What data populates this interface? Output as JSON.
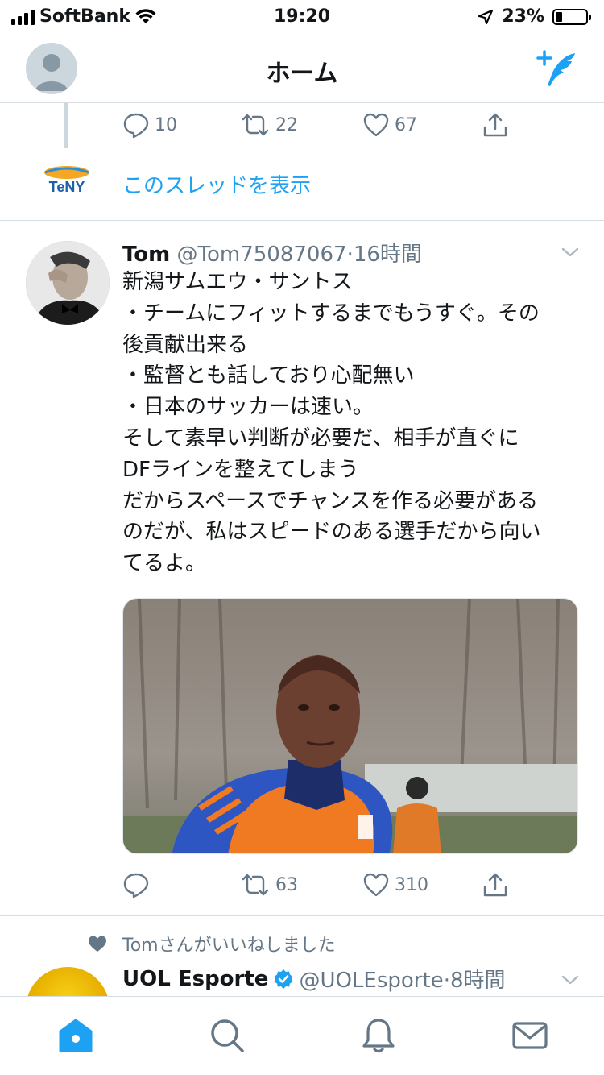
{
  "status_bar": {
    "carrier": "SoftBank",
    "time": "19:20",
    "battery_percent": "23%",
    "battery_level": 0.23
  },
  "header": {
    "title": "ホーム",
    "avatar_icon": "default-profile-icon",
    "compose_icon": "compose-tweet-icon"
  },
  "thread_tail": {
    "reply_count": "10",
    "retweet_count": "22",
    "like_count": "67",
    "show_thread_label": "このスレッドを表示",
    "logo_text": "TeNY"
  },
  "tweet": {
    "name": "Tom",
    "handle": "@Tom75087067",
    "separator": "·",
    "time": "16時間",
    "lines": [
      "新潟サムエウ・サントス",
      "・チームにフィットするまでもうすぐ。その",
      "後貢献出来る",
      "・監督とも話しており心配無い",
      "・日本のサッカーは速い。",
      "そして素早い判断が必要だ、相手が直ぐに",
      "DFラインを整えてしまう",
      "だからスペースでチャンスを作る必要がある",
      "のだが、私はスピードのある選手だから向い",
      "てるよ。"
    ],
    "reply_count": "",
    "retweet_count": "63",
    "like_count": "310"
  },
  "liked_notice": {
    "text": "Tomさんがいいねしました"
  },
  "next_tweet": {
    "name": "UOL Esporte",
    "handle": "@UOLEsporte",
    "separator": "·",
    "time": "8時間"
  },
  "tab_bar": {
    "tabs": [
      "home-icon",
      "search-icon",
      "notifications-icon",
      "messages-icon"
    ]
  },
  "colors": {
    "accent": "#1da1f2",
    "muted": "#657786",
    "divider": "#d6dde3",
    "text": "#14171a"
  }
}
